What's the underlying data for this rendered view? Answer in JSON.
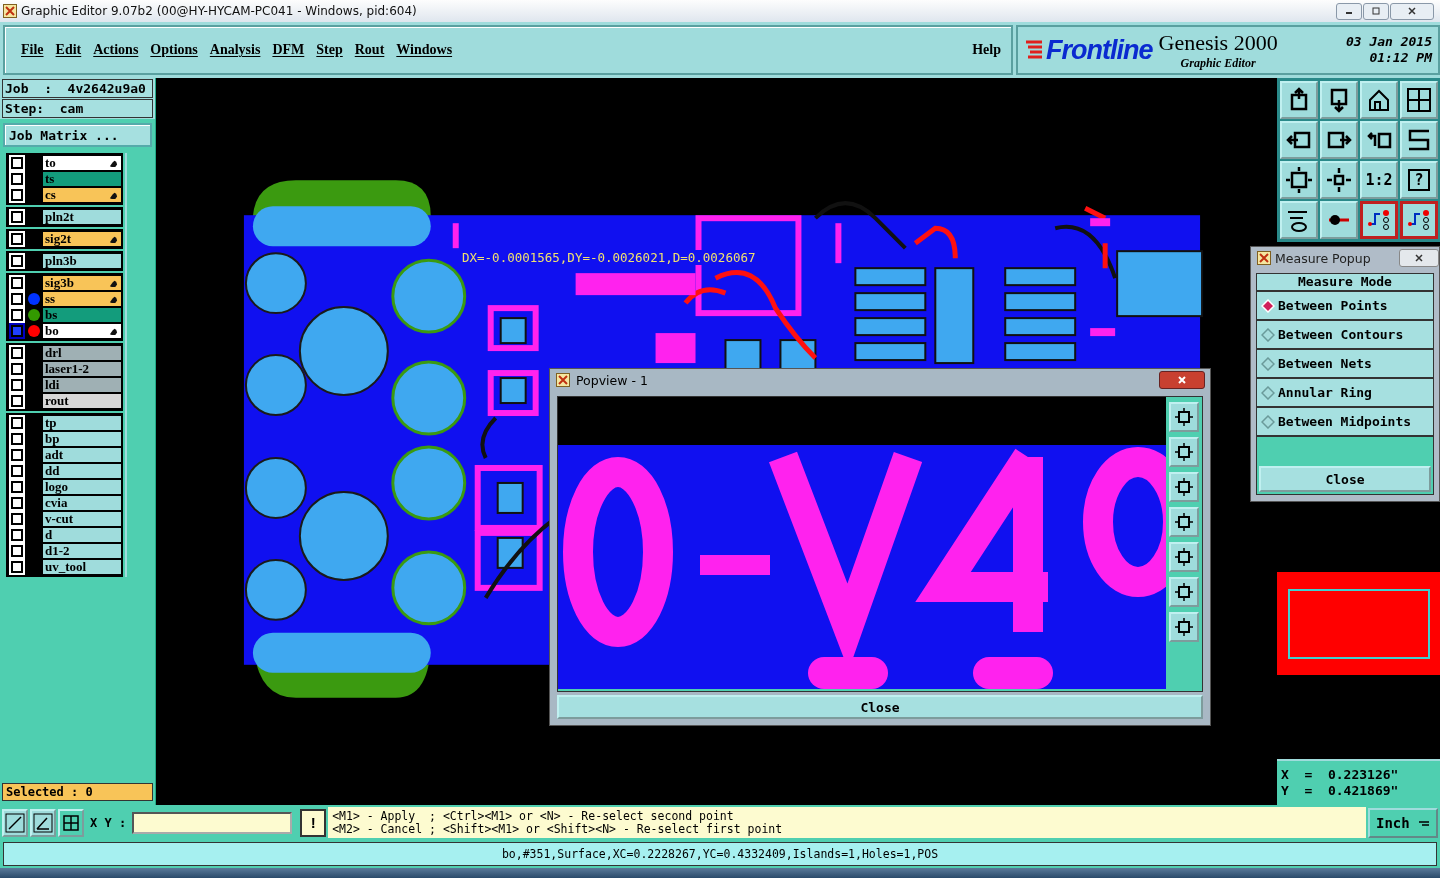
{
  "title_bar": {
    "title": "Graphic Editor 9.07b2 (00@HY-HYCAM-PC041 - Windows, pid:604)"
  },
  "menu": [
    "File",
    "Edit",
    "Actions",
    "Options",
    "Analysis",
    "DFM",
    "Step",
    "Rout",
    "Windows"
  ],
  "help": "Help",
  "brand": {
    "logo": "Frontline",
    "product": "Genesis 2000",
    "subtitle": "Graphic Editor",
    "date": "03 Jan 2015",
    "time": "01:12 PM"
  },
  "job": {
    "job": "Job  :  4v2642u9a0",
    "step": "Step:  cam",
    "matrix_button": "Job Matrix ..."
  },
  "layer_groups": [
    [
      {
        "name": "to",
        "color": "#ffffff",
        "edit": true,
        "work": false
      },
      {
        "name": "ts",
        "color": "#139c7c",
        "edit": false,
        "work": false
      },
      {
        "name": "cs",
        "color": "#f8c458",
        "edit": true,
        "work": false
      }
    ],
    [
      {
        "name": "pln2t",
        "color": "#9fdcdc",
        "edit": false,
        "work": false
      }
    ],
    [
      {
        "name": "sig2t",
        "color": "#f8c458",
        "edit": true,
        "work": false
      }
    ],
    [
      {
        "name": "pln3b",
        "color": "#9fdcdc",
        "edit": false,
        "work": false
      }
    ],
    [
      {
        "name": "sig3b",
        "color": "#f8c458",
        "edit": true,
        "work": false
      },
      {
        "name": "ss",
        "color": "#f8c458",
        "dot": {
          "color": "#0033ff"
        },
        "edit": true,
        "work": false
      },
      {
        "name": "bs",
        "color": "#139c7c",
        "dot": {
          "color": "#339900"
        },
        "edit": false,
        "work": false
      },
      {
        "name": "bo",
        "color": "#ffffff",
        "dot": {
          "color": "#ff0000"
        },
        "edit": true,
        "work": true
      }
    ],
    [
      {
        "name": "drl",
        "color": "#9fb0b4",
        "edit": false,
        "work": false
      },
      {
        "name": "laser1-2",
        "color": "#9fb0b4",
        "edit": false,
        "work": false
      },
      {
        "name": "ldi",
        "color": "#9fb0b4",
        "edit": false,
        "work": false
      },
      {
        "name": "rout",
        "color": "#d8d8d8",
        "edit": false,
        "work": false
      }
    ],
    [
      {
        "name": "tp",
        "color": "#9fdcdc",
        "edit": false,
        "work": false
      },
      {
        "name": "bp",
        "color": "#9fdcdc",
        "edit": false,
        "work": false
      },
      {
        "name": "adt",
        "color": "#9fdcdc",
        "edit": false,
        "work": false
      },
      {
        "name": "dd",
        "color": "#9fdcdc",
        "edit": false,
        "work": false
      },
      {
        "name": "logo",
        "color": "#9fdcdc",
        "edit": false,
        "work": false
      },
      {
        "name": "cvia",
        "color": "#9fdcdc",
        "edit": false,
        "work": false
      },
      {
        "name": "v-cut",
        "color": "#9fdcdc",
        "edit": false,
        "work": false
      },
      {
        "name": "d",
        "color": "#9fdcdc",
        "edit": false,
        "work": false
      },
      {
        "name": "d1-2",
        "color": "#9fdcdc",
        "edit": false,
        "work": false
      },
      {
        "name": "uv_tool",
        "color": "#9fdcdc",
        "edit": false,
        "work": false
      }
    ]
  ],
  "selected_count": "Selected : 0",
  "measure_label": "DX=-0.0001565,DY=-0.0026021,D=0.0026067",
  "popview": {
    "title": "Popview - 1",
    "close": "Close"
  },
  "measure_popup": {
    "title": "Measure Popup",
    "heading": "Measure Mode",
    "options": [
      {
        "label": "Between Points",
        "selected": true
      },
      {
        "label": "Between Contours",
        "selected": false
      },
      {
        "label": "Between Nets",
        "selected": false
      },
      {
        "label": "Annular Ring",
        "selected": false
      },
      {
        "label": "Between Midpoints",
        "selected": false
      }
    ],
    "close": "Close"
  },
  "toolbar": {
    "scale_label": "1:2",
    "help_label": "?"
  },
  "coords": {
    "x": "X  =  0.223126\"",
    "y": "Y  =  0.421869\""
  },
  "input": {
    "label": "X Y :",
    "warning": "!"
  },
  "hints": [
    "<M1> - Apply  ; <Ctrl><M1> or <N> - Re-select second point",
    "<M2> - Cancel ; <Shift><M1> or <Shift><N> - Re-select first point"
  ],
  "units": "Inch",
  "status": "bo,#351,Surface,XC=0.2228267,YC=0.4332409,Islands=1,Holes=1,POS"
}
